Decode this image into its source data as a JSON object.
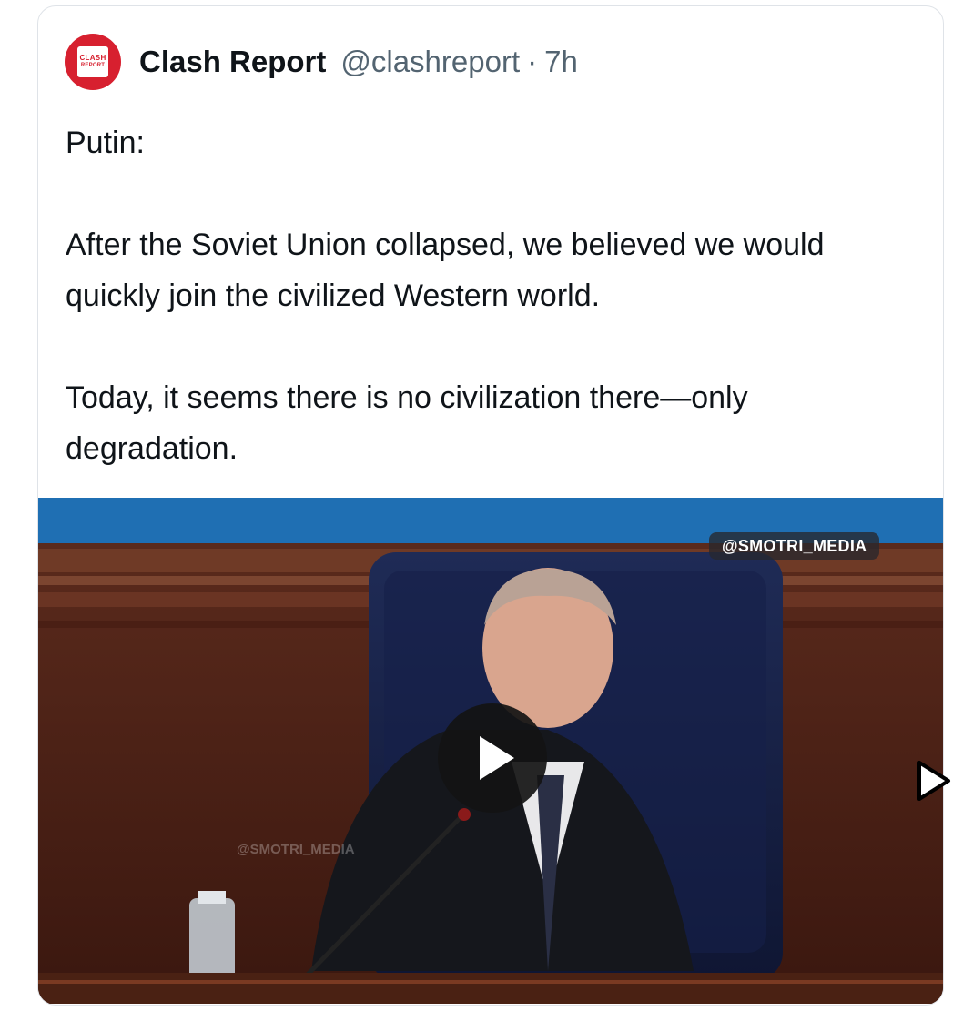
{
  "post": {
    "author": {
      "name": "Clash Report",
      "handle": "@clashreport",
      "separator": "·",
      "time": "7h",
      "avatar_line1": "CLASH",
      "avatar_line2": "REPORT"
    },
    "text": {
      "p1": "Putin:",
      "p2": "After the Soviet Union collapsed, we believed we would quickly join the civilized Western world.",
      "p3": "Today, it seems there is no civilization there—only degradation."
    },
    "media": {
      "type": "video",
      "watermark": "@SMOTRI_MEDIA",
      "watermark_faint": "@SMOTRI_MEDIA",
      "play_icon": "play-icon"
    }
  },
  "nav": {
    "next_icon": "cursor-arrow-icon"
  },
  "colors": {
    "accent": "#d7202f",
    "text": "#0f1419",
    "muted": "#536471"
  }
}
